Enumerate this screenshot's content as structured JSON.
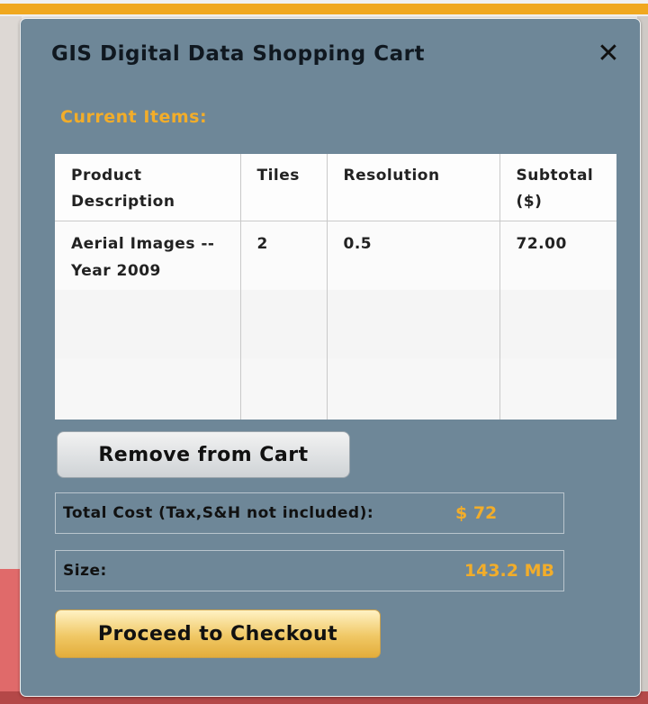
{
  "dialog": {
    "title": "GIS Digital Data Shopping Cart",
    "close_glyph": "✕",
    "section_label": "Current Items:"
  },
  "table": {
    "columns": [
      "Product Description",
      "Tiles",
      "Resolution",
      "Subtotal ($)"
    ],
    "rows": [
      {
        "product": "Aerial Images -- Year 2009",
        "tiles": "2",
        "resolution": "0.5",
        "subtotal": "72.00"
      }
    ]
  },
  "buttons": {
    "remove": "Remove from Cart",
    "checkout": "Proceed to Checkout"
  },
  "summary": {
    "total_label": "Total Cost (Tax,S&H not included):",
    "total_value": "$ 72",
    "size_label": "Size:",
    "size_value": "143.2 MB"
  },
  "colors": {
    "dialog_bg": "#6e8798",
    "accent": "#f2ad2a",
    "page_bar": "#f0a81f"
  },
  "icons": {
    "close": "close-icon"
  }
}
